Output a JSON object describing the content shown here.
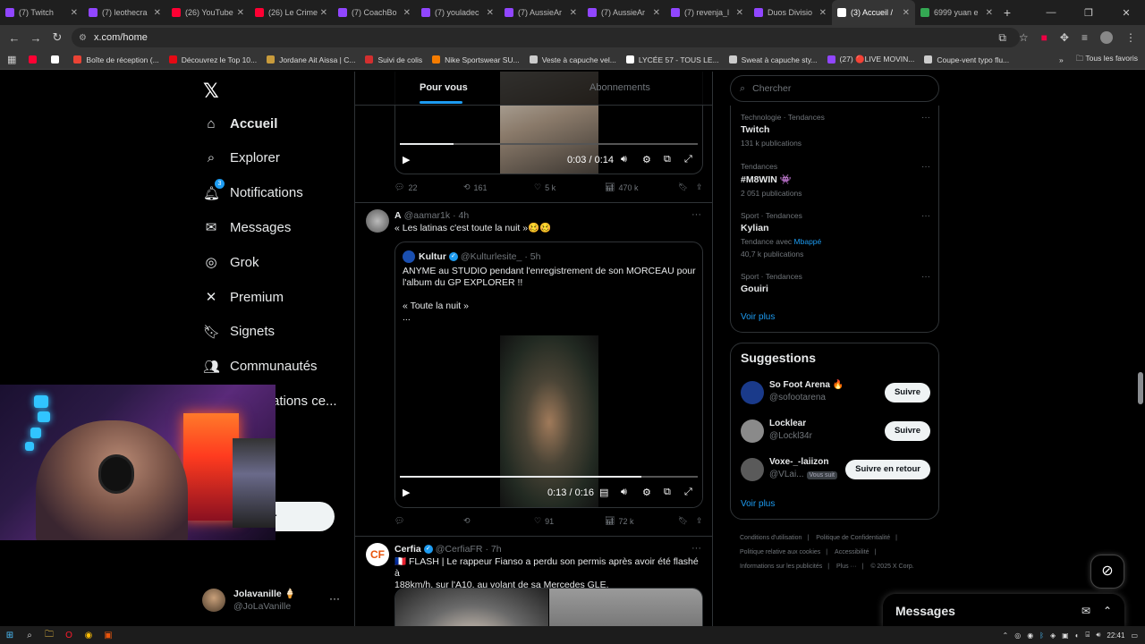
{
  "browser": {
    "tabs": [
      {
        "label": "(7) Twitch",
        "color": "#9146ff"
      },
      {
        "label": "(7) leothecra",
        "color": "#9146ff"
      },
      {
        "label": "(26) YouTube",
        "color": "#ff0033"
      },
      {
        "label": "(26) Le Crime",
        "color": "#ff0033"
      },
      {
        "label": "(7) CoachBo",
        "color": "#9146ff"
      },
      {
        "label": "(7) youladec",
        "color": "#9146ff"
      },
      {
        "label": "(7) AussieAr",
        "color": "#9146ff"
      },
      {
        "label": "(7) AussieAr",
        "color": "#9146ff"
      },
      {
        "label": "(7) revenja_l",
        "color": "#9146ff"
      },
      {
        "label": "Duos Divisio",
        "color": "#9146ff"
      },
      {
        "label": "(3) Accueil /",
        "color": "#ffffff",
        "active": true
      },
      {
        "label": "6999 yuan e",
        "color": "#34a853"
      }
    ],
    "url": "x.com/home",
    "bookmarks": [
      {
        "label": "",
        "color": "#ff0033"
      },
      {
        "label": "",
        "color": "#ffffff"
      },
      {
        "label": "Boîte de réception (...",
        "color": "#ea4335"
      },
      {
        "label": "Découvrez le Top 10...",
        "color": "#e50914"
      },
      {
        "label": "Jordane Ait Aissa | C...",
        "color": "#c89b3c"
      },
      {
        "label": "Suivi de colis",
        "color": "#d32f2f"
      },
      {
        "label": "Nike Sportswear SU...",
        "color": "#f57c00"
      },
      {
        "label": "Veste à capuche vel...",
        "color": "#cccccc"
      },
      {
        "label": "LYCÉE 57 - TOUS LE...",
        "color": "#ffffff"
      },
      {
        "label": "Sweat à capuche sty...",
        "color": "#cccccc"
      },
      {
        "label": "(27) 🔴LIVE MOVIN...",
        "color": "#9146ff"
      },
      {
        "label": "Coupe-vent typo flu...",
        "color": "#cccccc"
      }
    ],
    "bookmarks_more": "»",
    "all_bookmarks": "Tous les favoris"
  },
  "nav": {
    "items": [
      {
        "label": "Accueil",
        "icon": "⌂",
        "name": "home"
      },
      {
        "label": "Explorer",
        "icon": "⌕",
        "name": "explore"
      },
      {
        "label": "Notifications",
        "icon": "🔔︎",
        "name": "notifications",
        "badge": "3"
      },
      {
        "label": "Messages",
        "icon": "✉",
        "name": "messages"
      },
      {
        "label": "Grok",
        "icon": "◎",
        "name": "grok"
      },
      {
        "label": "Premium",
        "icon": "✕",
        "name": "premium"
      },
      {
        "label": "Signets",
        "icon": "🔖︎",
        "name": "bookmarks"
      },
      {
        "label": "Communautés",
        "icon": "👥︎",
        "name": "communities"
      },
      {
        "label": "ations ce...",
        "icon": "",
        "name": "verified-orgs"
      }
    ],
    "post_label": "er",
    "account": {
      "name": "Jolavanille 🍦",
      "handle": "@JoLaVanille"
    }
  },
  "feed": {
    "tabs": {
      "for_you": "Pour vous",
      "following": "Abonnements"
    },
    "tweet0": {
      "video_time": "0:03 / 0:14",
      "progress": 0.18,
      "replies": "22",
      "retweets": "161",
      "likes": "5 k",
      "views": "470 k"
    },
    "tweet1": {
      "name": "A",
      "handle": "@aamar1k",
      "time": "· 4h",
      "text": "« Les latinas c'est toute la nuit »🥴🥴",
      "quote": {
        "name": "Kultur",
        "handle": "@Kulturlesite_",
        "time": "· 5h",
        "line1": "ANYME au STUDIO pendant l'enregistrement de son MORCEAU pour",
        "line2": "l'album du GP EXPLORER !!",
        "line3": "« Toute la nuit »",
        "line4": "...",
        "video_time": "0:13 / 0:16",
        "progress": 0.81
      },
      "replies": "",
      "retweets": "",
      "likes": "91",
      "views": "72 k"
    },
    "tweet2": {
      "name": "Cerfia",
      "handle": "@CerfiaFR",
      "time": "· 7h",
      "line1": "🇫🇷 FLASH | Le rappeur Fianso a perdu son permis après avoir été flashé à",
      "line2": "188km/h, sur l'A10, au volant de sa Mercedes GLE."
    }
  },
  "sidebar": {
    "search_placeholder": "Chercher",
    "trends": [
      {
        "category": "Technologie · Tendances",
        "title": "Twitch",
        "posts": "131 k publications"
      },
      {
        "category": "Tendances",
        "title": "#M8WIN 👾",
        "posts": "2 051 publications"
      },
      {
        "category": "Sport · Tendances",
        "title": "Kylian",
        "posts_prefix": "Tendance avec ",
        "posts_link": "Mbappé",
        "posts": "40,7 k publications"
      },
      {
        "category": "Sport · Tendances",
        "title": "Gouiri",
        "posts": ""
      }
    ],
    "show_more": "Voir plus",
    "suggestions_title": "Suggestions",
    "suggestions": [
      {
        "name": "So Foot Arena 🔥",
        "handle": "@sofootarena",
        "button": "Suivre",
        "color": "#1a3a8a"
      },
      {
        "name": "Locklear",
        "handle": "@Lockl34r",
        "button": "Suivre",
        "color": "#8a8a8a"
      },
      {
        "name": "Voxe-_-laiizon",
        "handle": "@VLai...",
        "follows_you": "Vous suit",
        "button": "Suivre en retour",
        "color": "#5a5a5a"
      }
    ],
    "show_more2": "Voir plus",
    "footer": {
      "l1": "Conditions d'utilisation",
      "l2": "Politique de Confidentialité",
      "l3": "Politique relative aux cookies",
      "l4": "Accessibilité",
      "l5": "Informations sur les publicités",
      "l6": "Plus ···",
      "l7": "© 2025 X Corp."
    }
  },
  "dock": {
    "messages": "Messages"
  },
  "taskbar": {
    "time": "22:41"
  }
}
